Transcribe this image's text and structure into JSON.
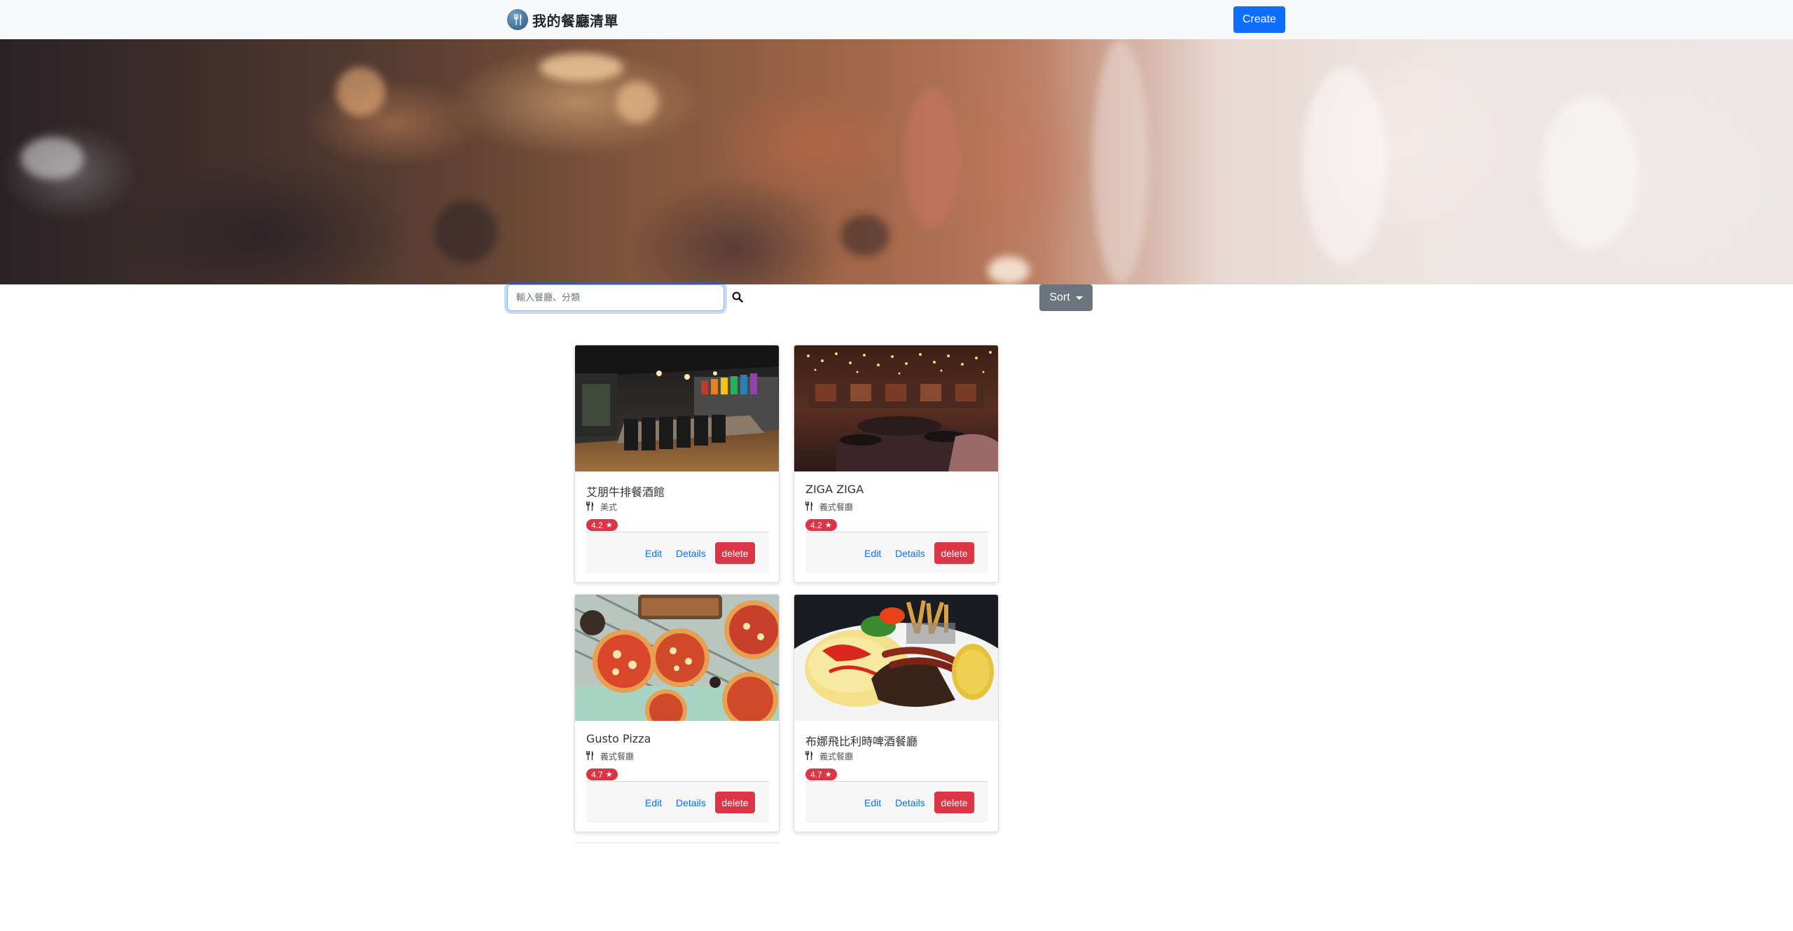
{
  "navbar": {
    "brand_text": "我的餐廳清單",
    "brand_icon": "utensils-logo-icon",
    "create_label": "Create"
  },
  "banner": {
    "image": "blurred restaurant interior banner"
  },
  "search": {
    "placeholder": "輸入餐廳、分類",
    "value": "",
    "icon": "search-icon"
  },
  "sort": {
    "label": "Sort"
  },
  "restaurants": [
    {
      "name": "艾朋牛排餐酒館",
      "category": "美式",
      "rating": "4.2",
      "edit_label": "Edit",
      "details_label": "Details",
      "delete_label": "delete"
    },
    {
      "name": "ZIGA ZIGA",
      "category": "義式餐廳",
      "rating": "4.2",
      "edit_label": "Edit",
      "details_label": "Details",
      "delete_label": "delete"
    },
    {
      "name": "Gusto Pizza",
      "category": "義式餐廳",
      "rating": "4.7",
      "edit_label": "Edit",
      "details_label": "Details",
      "delete_label": "delete"
    },
    {
      "name": "布娜飛比利時啤酒餐廳",
      "category": "義式餐廳",
      "rating": "4.7",
      "edit_label": "Edit",
      "details_label": "Details",
      "delete_label": "delete"
    }
  ],
  "colors": {
    "primary": "#0d6efd",
    "secondary": "#6c757d",
    "danger": "#dc3545",
    "navbar_bg": "#f8f9fa"
  }
}
